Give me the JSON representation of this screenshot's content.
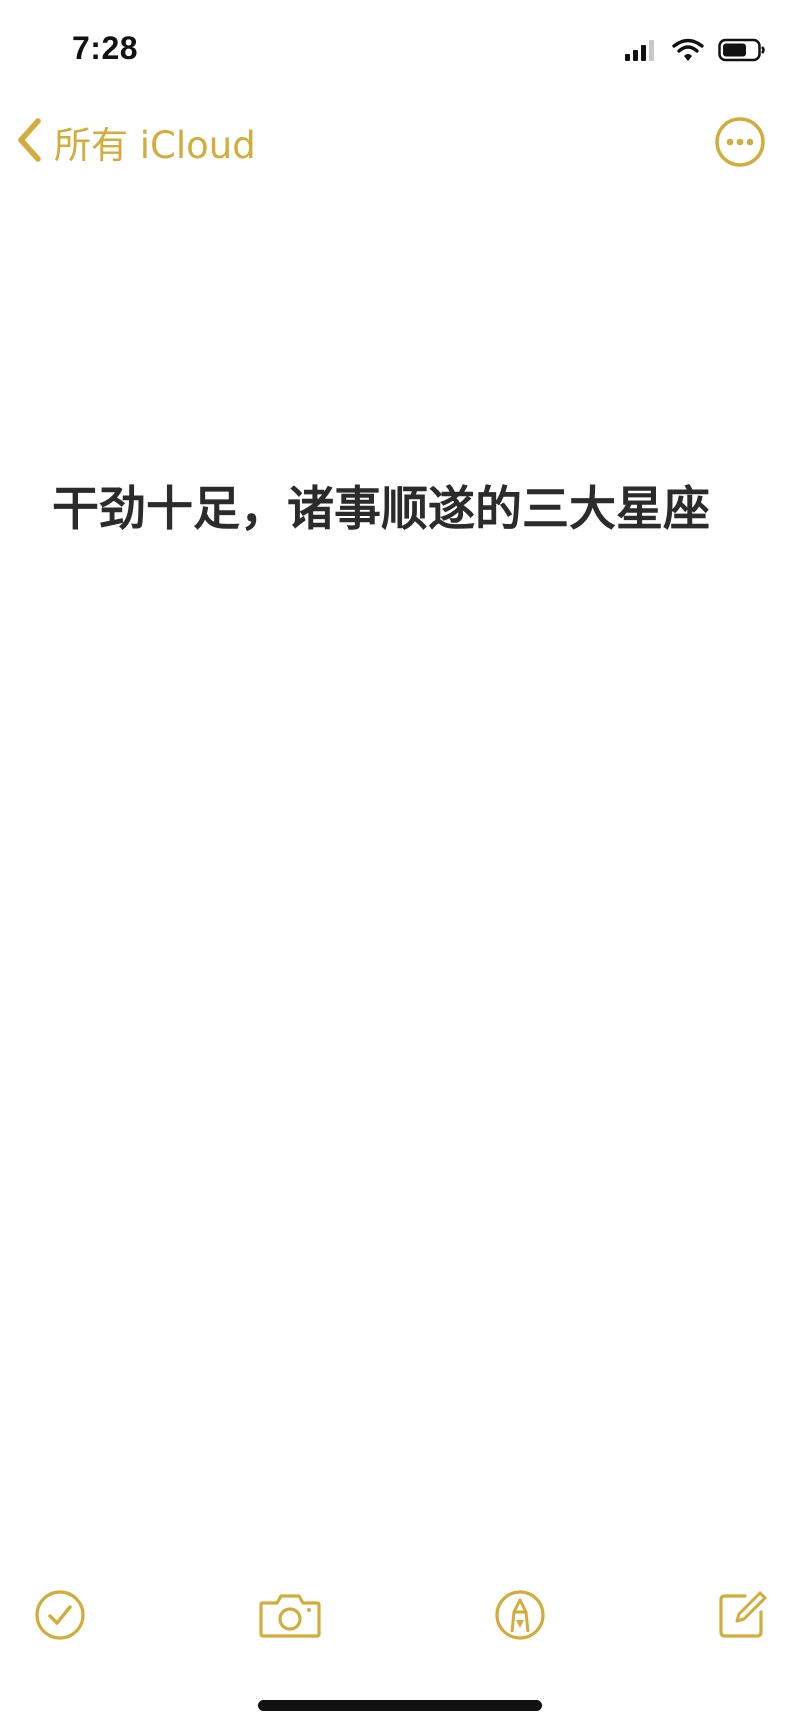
{
  "status_bar": {
    "time": "7:28",
    "signal_icon": "cellular-signal-icon",
    "wifi_icon": "wifi-icon",
    "battery_icon": "battery-icon"
  },
  "nav": {
    "back_label": "所有 iCloud",
    "back_icon": "chevron-left-icon",
    "more_icon": "ellipsis-circle-icon"
  },
  "note": {
    "title": "干劲十足，诸事顺遂的三大星座"
  },
  "toolbar": {
    "checklist_icon": "checklist-icon",
    "camera_icon": "camera-icon",
    "markup_icon": "markup-pen-icon",
    "compose_icon": "compose-icon"
  },
  "colors": {
    "accent": "#d4ac3b",
    "text": "#2b2b2b",
    "background": "#ffffff"
  }
}
